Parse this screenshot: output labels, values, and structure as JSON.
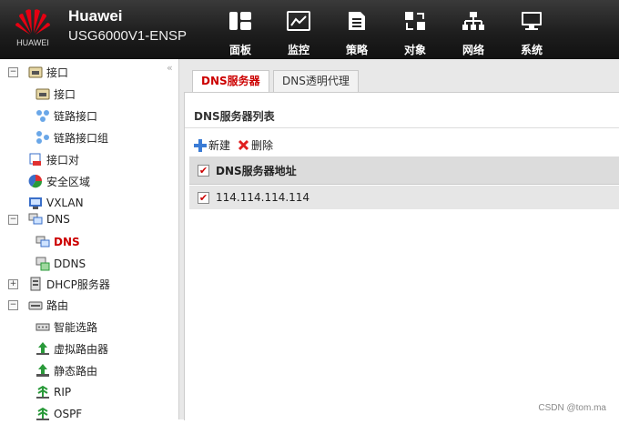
{
  "brand": {
    "logo_text": "HUAWEI",
    "name": "Huawei",
    "model": "USG6000V1-ENSP"
  },
  "nav": [
    {
      "label": "面板",
      "icon": "dashboard-icon"
    },
    {
      "label": "监控",
      "icon": "monitor-icon"
    },
    {
      "label": "策略",
      "icon": "policy-icon"
    },
    {
      "label": "对象",
      "icon": "object-icon"
    },
    {
      "label": "网络",
      "icon": "network-icon",
      "active": true
    },
    {
      "label": "系统",
      "icon": "system-icon"
    }
  ],
  "sidebar": {
    "collapse_glyph": "«",
    "items": [
      {
        "label": "接口",
        "toggle": "−",
        "icon": "interface-icon"
      },
      {
        "label": "接口",
        "icon": "interface-icon"
      },
      {
        "label": "链路接口",
        "icon": "link-interface-icon"
      },
      {
        "label": "链路接口组",
        "icon": "link-interface-group-icon"
      },
      {
        "label": "接口对",
        "icon": "interface-pair-icon"
      },
      {
        "label": "安全区域",
        "icon": "security-zone-icon"
      },
      {
        "label": "VXLAN",
        "icon": "vxlan-icon"
      },
      {
        "label": "DNS",
        "toggle": "−",
        "icon": "dns-icon"
      },
      {
        "label": "DNS",
        "icon": "dns-icon",
        "selected": true
      },
      {
        "label": "DDNS",
        "icon": "ddns-icon"
      },
      {
        "label": "DHCP服务器",
        "toggle": "+",
        "icon": "dhcp-server-icon"
      },
      {
        "label": "路由",
        "toggle": "−",
        "icon": "routing-icon"
      },
      {
        "label": "智能选路",
        "icon": "smart-routing-icon"
      },
      {
        "label": "虚拟路由器",
        "icon": "virtual-router-icon"
      },
      {
        "label": "静态路由",
        "icon": "static-route-icon"
      },
      {
        "label": "RIP",
        "icon": "rip-icon"
      },
      {
        "label": "OSPF",
        "icon": "ospf-icon"
      }
    ]
  },
  "tabs": [
    {
      "label": "DNS服务器",
      "active": true
    },
    {
      "label": "DNS透明代理"
    }
  ],
  "panel": {
    "title": "DNS服务器列表",
    "toolbar": {
      "add_label": "新建",
      "delete_label": "删除"
    },
    "table": {
      "header": "DNS服务器地址",
      "rows": [
        "114.114.114.114"
      ],
      "check_glyph": "✔"
    }
  },
  "watermark": "CSDN @tom.ma",
  "colors": {
    "header_bg": "#222222",
    "accent_red": "#cc0000",
    "logo_red": "#e60012"
  }
}
